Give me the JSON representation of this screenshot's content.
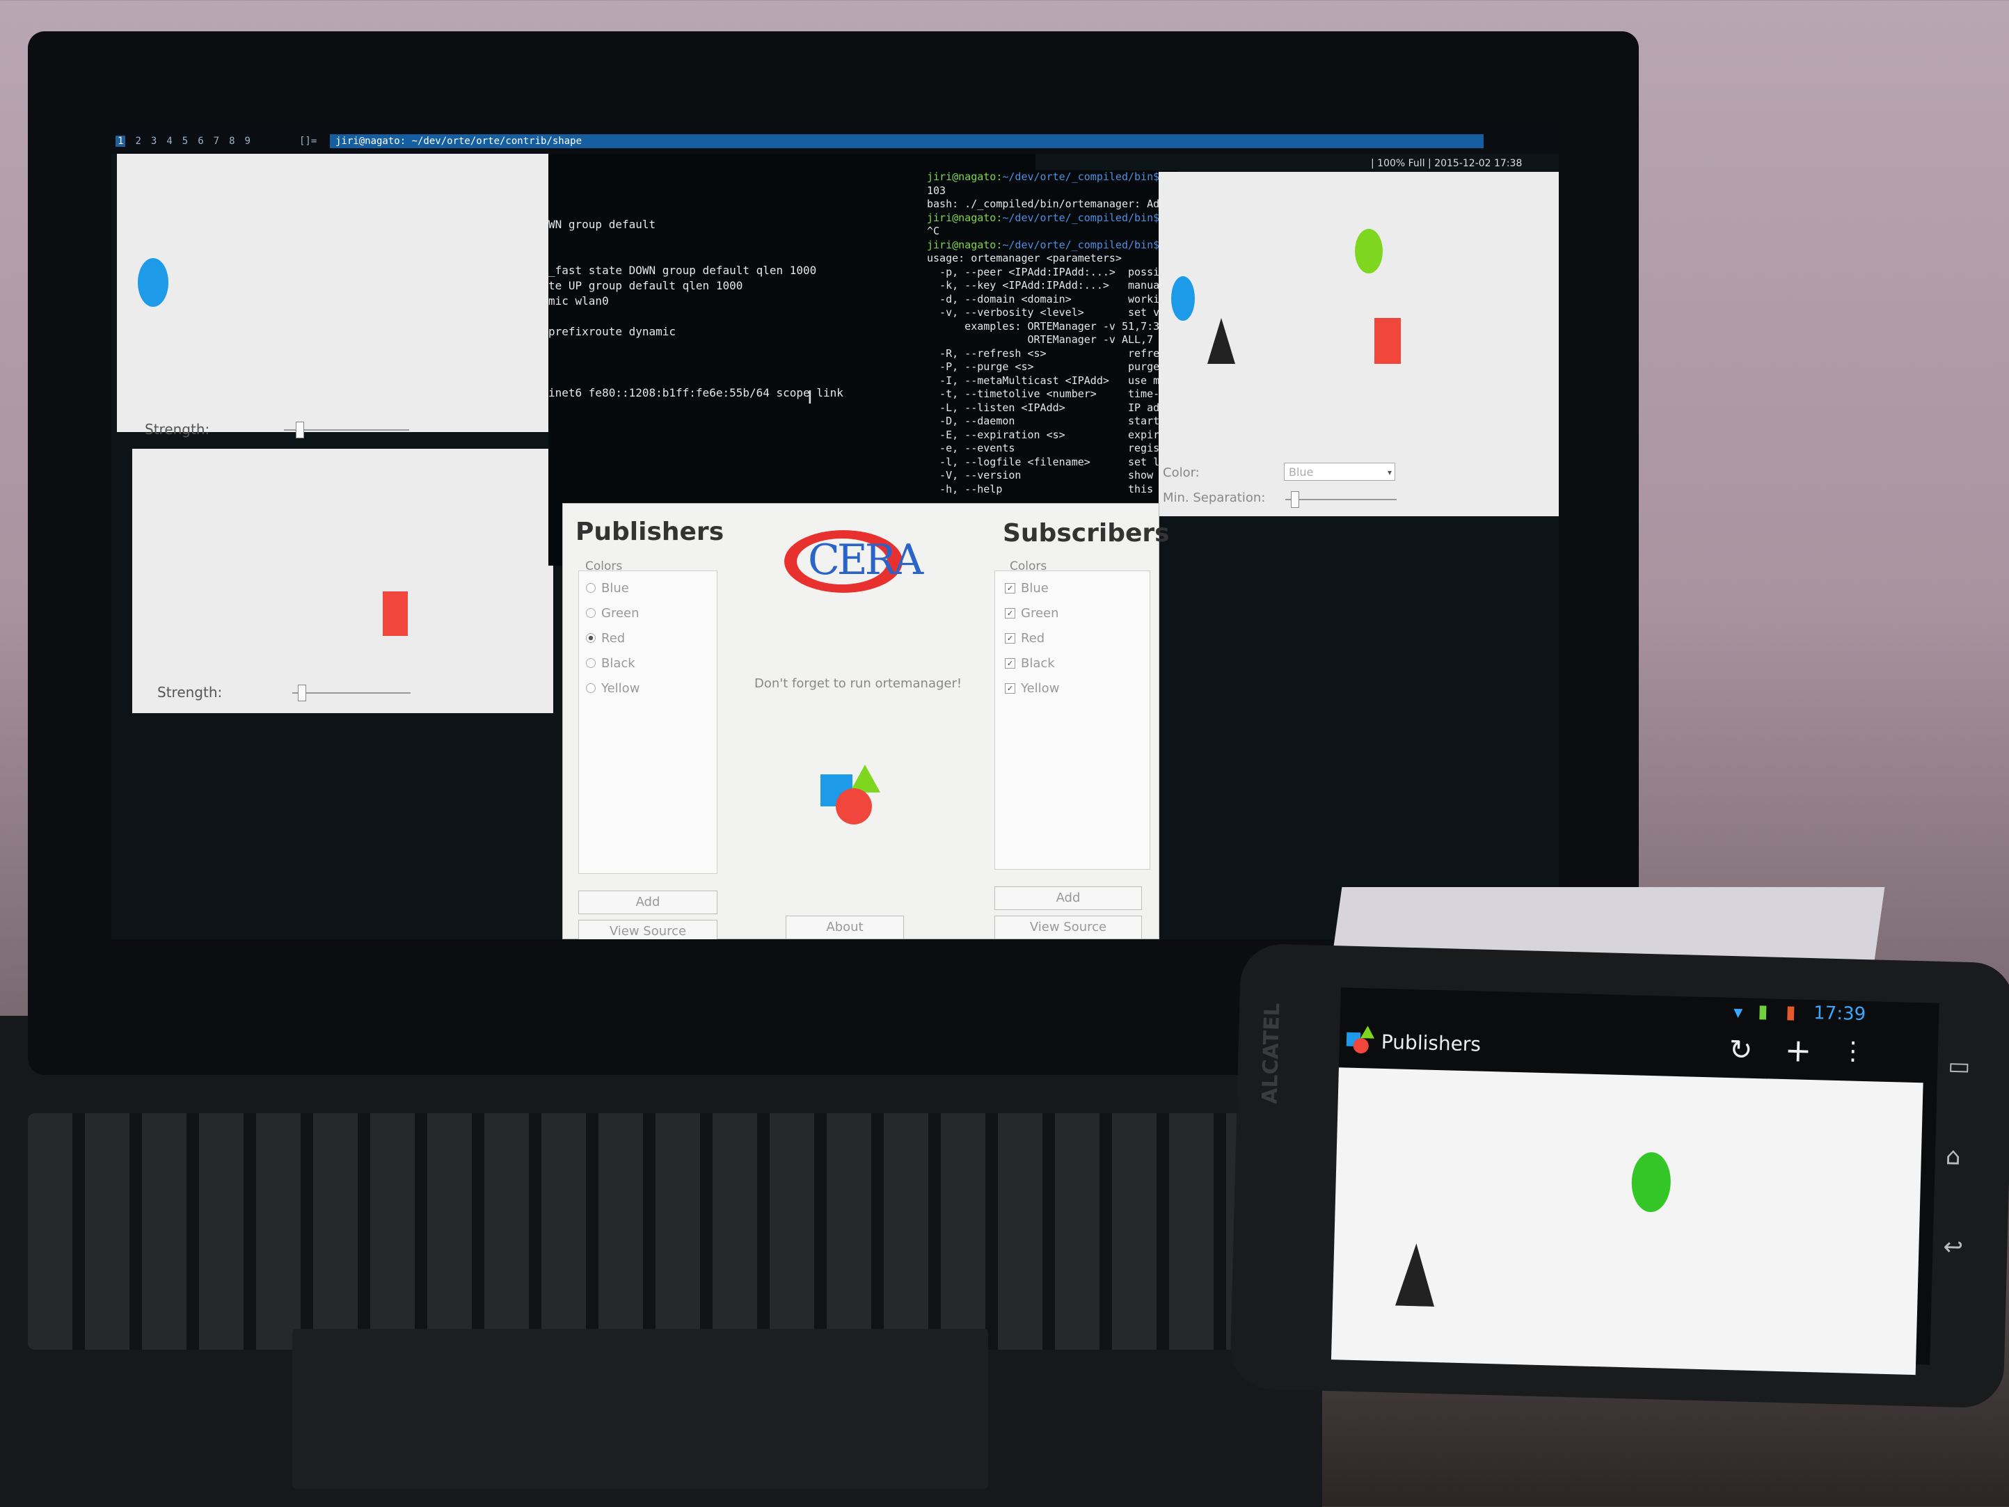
{
  "top_bar": {
    "workspaces": [
      "1",
      "2",
      "3",
      "4",
      "5",
      "6",
      "7",
      "8",
      "9"
    ],
    "layout_indicator": "[]=",
    "window_title": "jiri@nagato: ~/dev/orte/orte/contrib/shape",
    "status": "| 100% Full | 2015-12-02 17:38"
  },
  "publisher_window_blue": {
    "strength_label": "Strength:",
    "strength": 0.1
  },
  "publisher_window_red": {
    "strength_label": "Strength:",
    "strength": 0.05
  },
  "terminal_ip": {
    "lines": [
      "WN group default",
      "",
      "",
      "_fast state DOWN group default qlen 1000",
      "te UP group default qlen 1000",
      "mic wlan0",
      "",
      "prefixroute dynamic",
      "",
      "",
      "",
      "inet6 fe80::1208:b1ff:fe6e:55b/64 scope link"
    ]
  },
  "terminal_ortemanager": {
    "lines": [
      {
        "prompt": "jiri@nagato:",
        "path": "~/dev/orte/_compiled/bin$",
        "text": ""
      },
      {
        "text": "103"
      },
      {
        "text": "bash: ./_compiled/bin/ortemanager: Ad"
      },
      {
        "prompt": "jiri@nagato:",
        "path": "~/dev/orte/_compiled/bin$",
        "text": ""
      },
      {
        "text": "^C"
      },
      {
        "prompt": "jiri@nagato:",
        "path": "~/dev/orte/_compiled/bin$",
        "text": ""
      },
      {
        "text": "usage: ortemanager <parameters>"
      },
      {
        "text": "  -p, --peer <IPAdd:IPAdd:...>  possi"
      },
      {
        "text": "  -k, --key <IPAdd:IPAdd:...>   manua"
      },
      {
        "text": "  -d, --domain <domain>         worki"
      },
      {
        "text": "  -v, --verbosity <level>       set v"
      },
      {
        "text": "      examples: ORTEManager -v 51,7:3"
      },
      {
        "text": "                ORTEManager -v ALL,7"
      },
      {
        "text": "  -R, --refresh <s>             refre"
      },
      {
        "text": "  -P, --purge <s>               purge"
      },
      {
        "text": "  -I, --metaMulticast <IPAdd>   use m"
      },
      {
        "text": "  -t, --timetolive <number>     time-"
      },
      {
        "text": "  -L, --listen <IPAdd>          IP ad"
      },
      {
        "text": "  -D, --daemon                  start"
      },
      {
        "text": "  -E, --expiration <s>          expir"
      },
      {
        "text": "  -e, --events                  regis"
      },
      {
        "text": "  -l, --logfile <filename>      set l"
      },
      {
        "text": "  -V, --version                 show"
      },
      {
        "text": "  -h, --help                    this"
      }
    ]
  },
  "subscriber_window": {
    "color_label": "Color:",
    "color_value": "Blue",
    "min_separation_label": "Min. Separation:",
    "min_separation": 0.05
  },
  "ortedemo": {
    "publishers": {
      "heading": "Publishers",
      "group_label": "Colors",
      "options": [
        {
          "label": "Blue",
          "selected": false
        },
        {
          "label": "Green",
          "selected": false
        },
        {
          "label": "Red",
          "selected": true
        },
        {
          "label": "Black",
          "selected": false
        },
        {
          "label": "Yellow",
          "selected": false
        }
      ],
      "add_label": "Add",
      "view_source_label": "View Source"
    },
    "center": {
      "logo_text": "CERA",
      "message": "Don't forget to run ortemanager!",
      "about_label": "About"
    },
    "subscribers": {
      "heading": "Subscribers",
      "group_label": "Colors",
      "options": [
        {
          "label": "Blue",
          "checked": true
        },
        {
          "label": "Green",
          "checked": true
        },
        {
          "label": "Red",
          "checked": true
        },
        {
          "label": "Black",
          "checked": true
        },
        {
          "label": "Yellow",
          "checked": true
        }
      ],
      "add_label": "Add",
      "view_source_label": "View Source"
    }
  },
  "phone": {
    "brand": "ALCATEL",
    "status_time": "17:39",
    "app_title": "Publishers"
  },
  "colors": {
    "blue": "#1e9be8",
    "green": "#7fd61f",
    "red": "#f0463c",
    "black": "#222222",
    "terminal_prompt": "#7cd64a",
    "terminal_path": "#4a8fe0",
    "title_bar": "#155fa0"
  }
}
